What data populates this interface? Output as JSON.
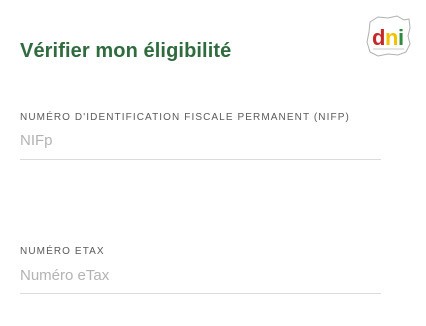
{
  "form": {
    "title": "Vérifier mon éligibilité",
    "logo_text": "dni",
    "fields": [
      {
        "label": "NUMÉRO D'IDENTIFICATION FISCALE PERMANENT (NIFP)",
        "value": "",
        "placeholder": "NIFp"
      },
      {
        "label": "NUMÉRO ETAX",
        "value": "",
        "placeholder": "Numéro eTax"
      }
    ]
  },
  "colors": {
    "title": "#2f6b3f",
    "label": "#5a5a5a",
    "placeholder": "#b3b3b3",
    "underline": "#dcdcdc",
    "logo_red": "#c62828",
    "logo_yellow": "#f2c200",
    "logo_green": "#2e8b3d"
  }
}
